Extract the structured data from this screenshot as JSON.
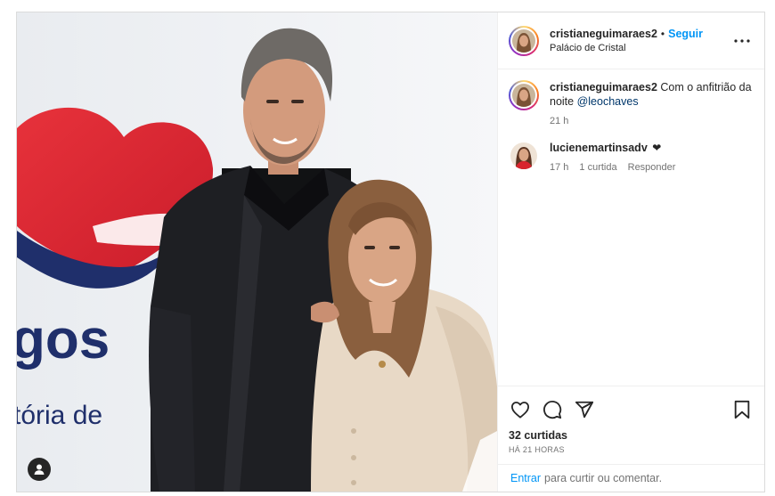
{
  "post": {
    "author": "cristianeguimaraes2",
    "follow_label": "Seguir",
    "location": "Palácio de Cristal",
    "caption_text": "Com o anfitrião da noite",
    "caption_mention": "@leochaves",
    "caption_time": "21 h",
    "likes": "32 curtidas",
    "posted_ago": "HÁ 21 HORAS",
    "login_label": "Entrar",
    "login_suffix": "para curtir ou comentar."
  },
  "comments": [
    {
      "user": "lucienemartinsadv",
      "text": "❤",
      "time": "17 h",
      "likes": "1 curtida",
      "reply_label": "Responder"
    }
  ],
  "photo": {
    "banner_text_1": "gos",
    "banner_text_2": "tória de"
  },
  "icons": {
    "more": "more-options-icon",
    "like": "heart-icon",
    "comment": "comment-icon",
    "share": "share-icon",
    "save": "bookmark-icon",
    "tags": "user-tag-icon"
  },
  "colors": {
    "accent": "#0095f6",
    "muted": "#737373",
    "border": "#dbdbdb"
  }
}
